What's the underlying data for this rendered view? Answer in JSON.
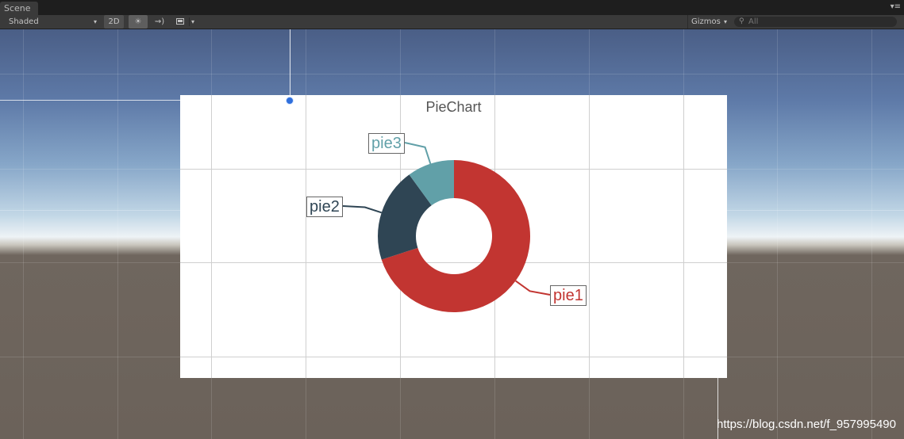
{
  "window": {
    "tab_label": "Scene",
    "menu_icon": "menu-icon"
  },
  "toolbar": {
    "shading_mode": "Shaded",
    "mode_2d_label": "2D",
    "lighting_icon": "sun-icon",
    "audio_icon": "audio-icon",
    "effects_icon": "image-icon",
    "gizmos_label": "Gizmos",
    "search_placeholder": "All"
  },
  "colors": {
    "pie1": "#c23531",
    "pie2": "#2f4554",
    "pie3": "#61a0a8"
  },
  "chart_data": {
    "type": "pie",
    "title": "PieChart",
    "donut": true,
    "labels": [
      "pie1",
      "pie2",
      "pie3"
    ],
    "values": [
      70,
      20,
      10
    ],
    "colors": [
      "#c23531",
      "#2f4554",
      "#61a0a8"
    ]
  },
  "watermark": "https://blog.csdn.net/f_957995490"
}
